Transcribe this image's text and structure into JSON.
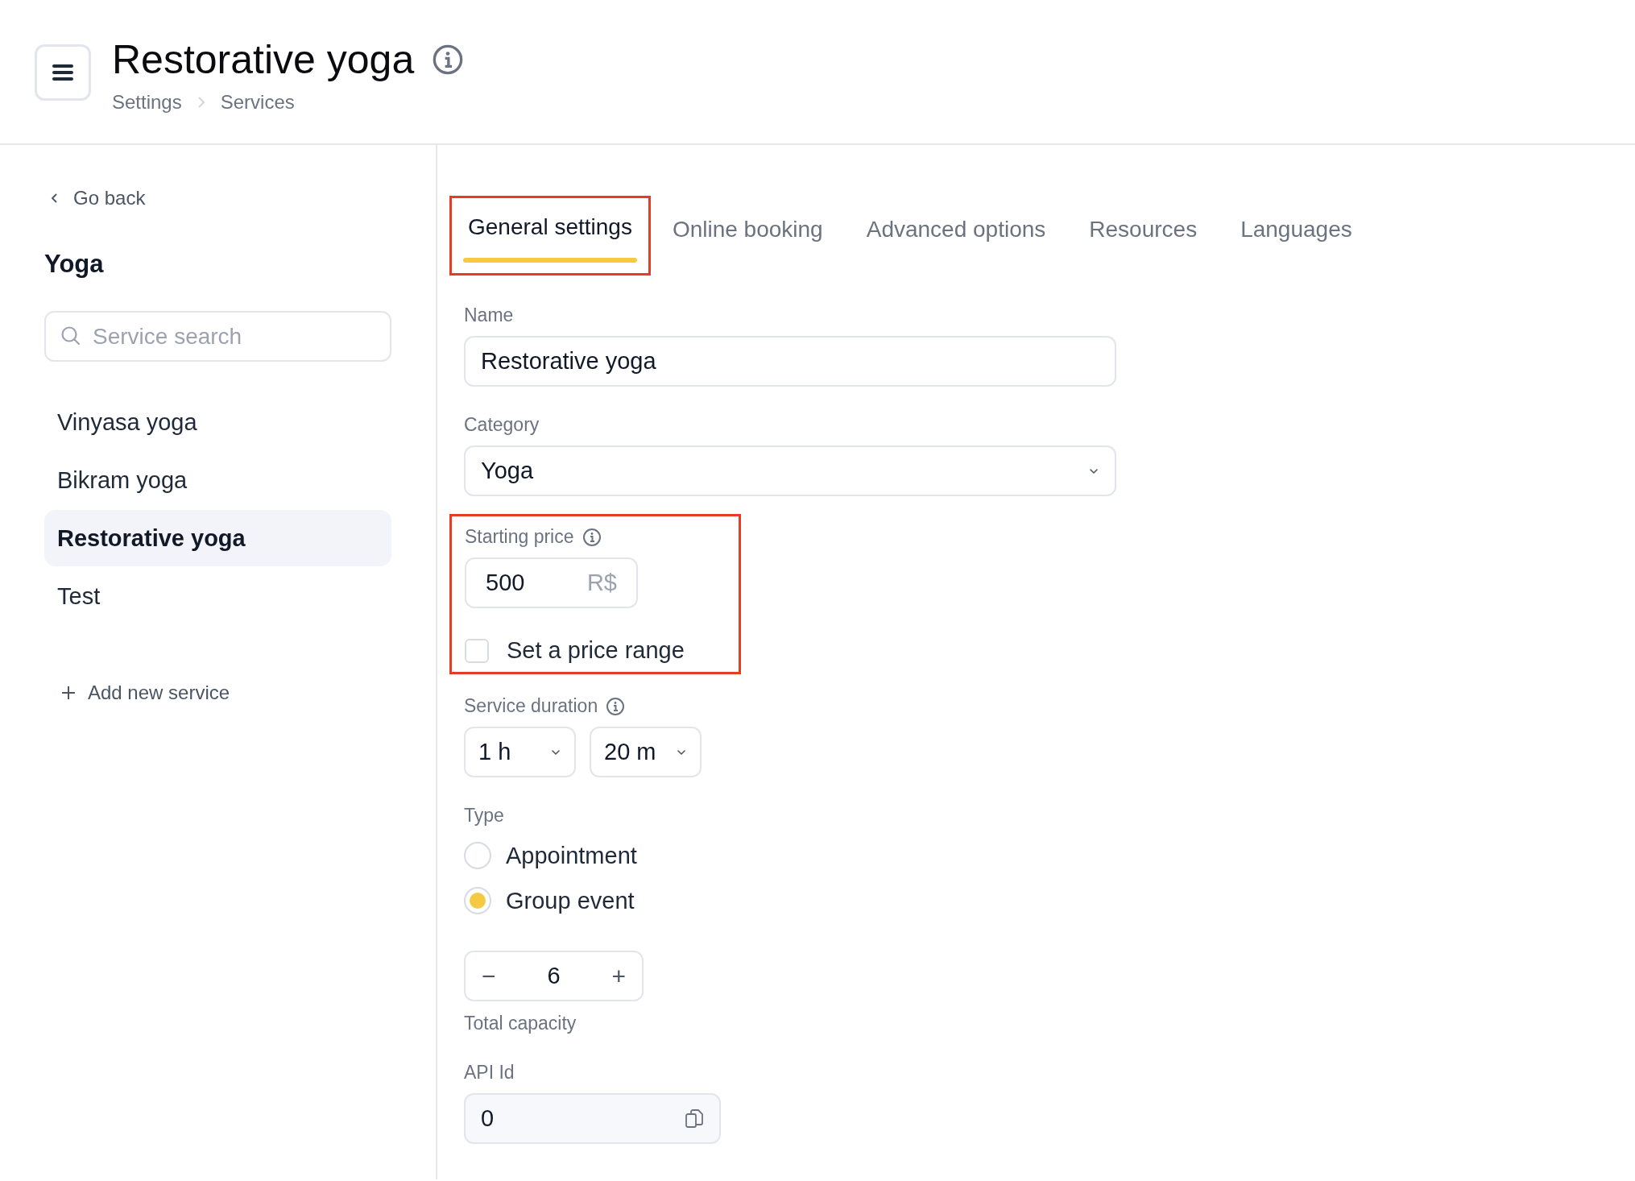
{
  "header": {
    "title": "Restorative yoga",
    "breadcrumb": [
      "Settings",
      "Services"
    ]
  },
  "sidebar": {
    "back_link": "Go back",
    "heading": "Yoga",
    "search": {
      "placeholder": "Service search"
    },
    "items": [
      {
        "label": "Vinyasa yoga",
        "selected": false
      },
      {
        "label": "Bikram yoga",
        "selected": false
      },
      {
        "label": "Restorative yoga",
        "selected": true
      },
      {
        "label": "Test",
        "selected": false
      }
    ],
    "add_button": "Add new service"
  },
  "tabs": [
    {
      "label": "General settings",
      "selected": true,
      "highlighted": true
    },
    {
      "label": "Online booking",
      "selected": false,
      "highlighted": false
    },
    {
      "label": "Advanced options",
      "selected": false,
      "highlighted": false
    },
    {
      "label": "Resources",
      "selected": false,
      "highlighted": false
    },
    {
      "label": "Languages",
      "selected": false,
      "highlighted": false
    }
  ],
  "form": {
    "name": {
      "label": "Name",
      "value": "Restorative yoga"
    },
    "category": {
      "label": "Category",
      "value": "Yoga"
    },
    "price": {
      "label": "Starting price",
      "value": "500",
      "currency": "R$",
      "highlighted": true,
      "range_checkbox": {
        "label": "Set a price range",
        "checked": false
      }
    },
    "duration": {
      "label": "Service duration",
      "hours": "1 h",
      "minutes": "20 m"
    },
    "type": {
      "label": "Type",
      "options": [
        {
          "label": "Appointment",
          "selected": false
        },
        {
          "label": "Group event",
          "selected": true
        }
      ]
    },
    "capacity": {
      "decrement": "−",
      "value": "6",
      "increment": "+",
      "label": "Total capacity"
    },
    "api_id": {
      "label": "API Id",
      "value": "0"
    }
  }
}
